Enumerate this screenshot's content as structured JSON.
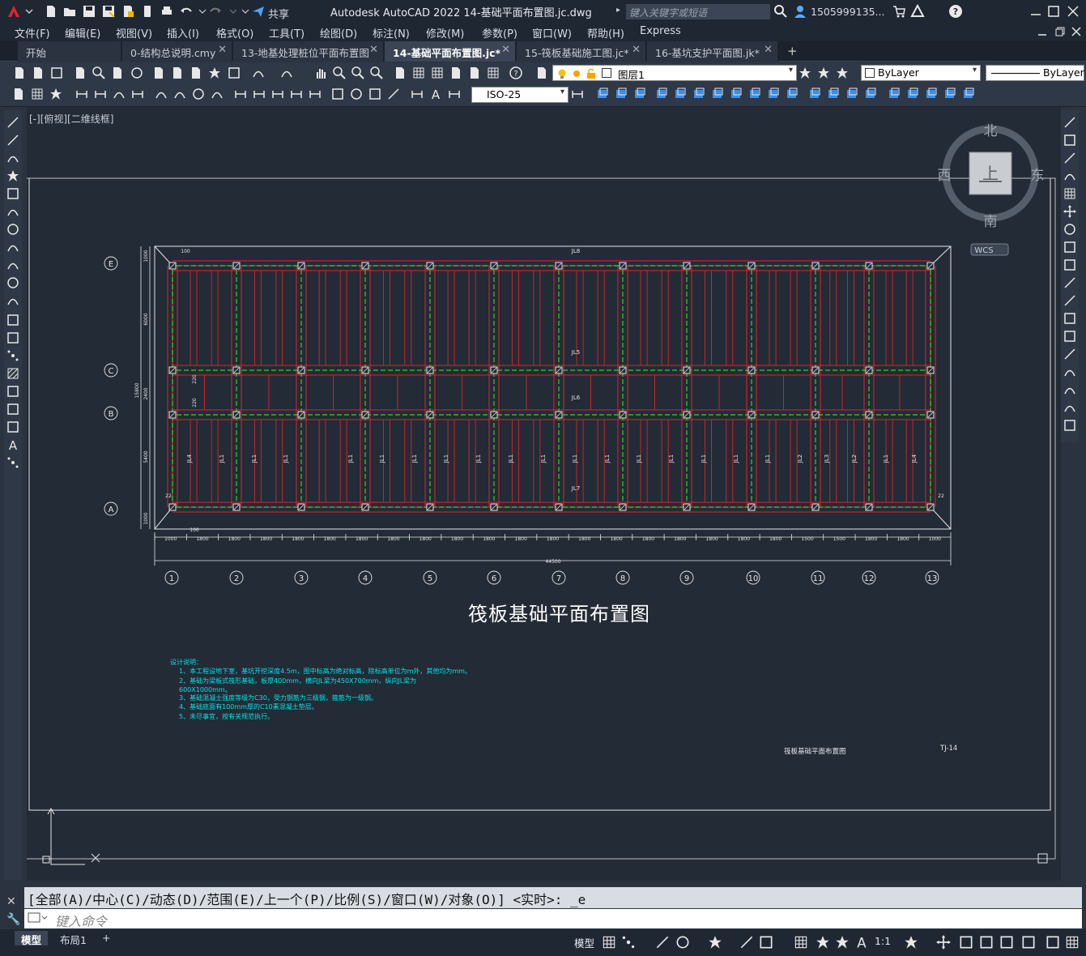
{
  "titlebar": {
    "app_icon": "autocad-a-icon",
    "title": "Autodesk AutoCAD 2022    14-基础平面布置图.jc.dwg",
    "share_label": "共享",
    "search_placeholder": "键入关键字或短语",
    "user_label": "1505999135...",
    "help_label": "?"
  },
  "menubar": {
    "items": [
      "文件(F)",
      "编辑(E)",
      "视图(V)",
      "插入(I)",
      "格式(O)",
      "工具(T)",
      "绘图(D)",
      "标注(N)",
      "修改(M)",
      "参数(P)",
      "窗口(W)",
      "帮助(H)",
      "Express"
    ]
  },
  "tabs": [
    {
      "label": "开始",
      "closable": false,
      "active": false
    },
    {
      "label": "0-结构总说明.cmy",
      "closable": true,
      "active": false
    },
    {
      "label": "13-地基处理桩位平面布置图",
      "closable": true,
      "active": false
    },
    {
      "label": "14-基础平面布置图.jc*",
      "closable": true,
      "active": true
    },
    {
      "label": "15-筏板基础施工图.jc*",
      "closable": true,
      "active": false
    },
    {
      "label": "16-基坑支护平面图.jk*",
      "closable": true,
      "active": false
    }
  ],
  "new_tab_label": "+",
  "toolbar": {
    "layer_value": "图层1",
    "color_value": "ByLayer",
    "linetype_value": "ByLayer",
    "dimstyle_value": "ISO-25"
  },
  "viewport_label": "[-][俯视][二维线框]",
  "viewcube": {
    "north": "北",
    "south": "南",
    "east": "东",
    "west": "西",
    "face": "上",
    "wcs": "WCS"
  },
  "drawing": {
    "title": "筏板基础平面布置图",
    "axis_rows": [
      "E",
      "C",
      "B",
      "A"
    ],
    "axis_cols": [
      "1",
      "2",
      "3",
      "4",
      "5",
      "6",
      "7",
      "8",
      "9",
      "10",
      "11",
      "12",
      "13"
    ],
    "beam_labels": [
      "JL8",
      "JL5",
      "JL6",
      "JL7"
    ],
    "col_beam_labels": [
      "JL4",
      "JL1",
      "JL1",
      "JL1",
      "JL1",
      "JL1",
      "JL1",
      "JL1",
      "JL1",
      "JL1",
      "JL1",
      "JL1",
      "JL1",
      "JL1",
      "JL1",
      "JL1",
      "JL1",
      "JL1",
      "JL2",
      "JL3",
      "JL2",
      "JL1",
      "JL4"
    ],
    "top_dims": [
      "1000",
      "1800",
      "1800",
      "1800",
      "1800",
      "1800",
      "1800",
      "1800",
      "1800",
      "1800",
      "1800",
      "1800",
      "1800",
      "1800",
      "1800",
      "1800",
      "1800",
      "1800",
      "1800",
      "1800",
      "1500",
      "1500",
      "1800",
      "1800",
      "1000"
    ],
    "total_dim": "44500",
    "left_dims": [
      "1000",
      "6000",
      "15800",
      "2400",
      "5400",
      "1000"
    ],
    "small_dims": [
      "100",
      "100",
      "220",
      "220",
      "22",
      "22"
    ],
    "notes_title": "设计说明：",
    "notes": [
      "1、本工程设地下室，基坑开挖深度4.5m，图中标高为绝对标高，除标高单位为m外，其他均为mm。",
      "2、基础为梁板式筏形基础，板厚400mm，横向JL梁为450X700mm，纵向JL梁为",
      "   600X1000mm。",
      "3、基础混凝土强度等级为C30，受力钢筋为三级钢，箍筋为一级钢。",
      "4、基础底面有100mm厚的C10素混凝土垫层。",
      "5、未尽事宜，按有关规范执行。"
    ],
    "titleblock_name": "筏板基础平面布置图",
    "titleblock_no": "TJ-14"
  },
  "command": {
    "history": "[全部(A)/中心(C)/动态(D)/范围(E)/上一个(P)/比例(S)/窗口(W)/对象(O)] <实时>: _e",
    "input_placeholder": "键入命令"
  },
  "status": {
    "layout_tabs": [
      "模型",
      "布局1"
    ],
    "model_label": "模型",
    "scale_label": "1:1"
  }
}
